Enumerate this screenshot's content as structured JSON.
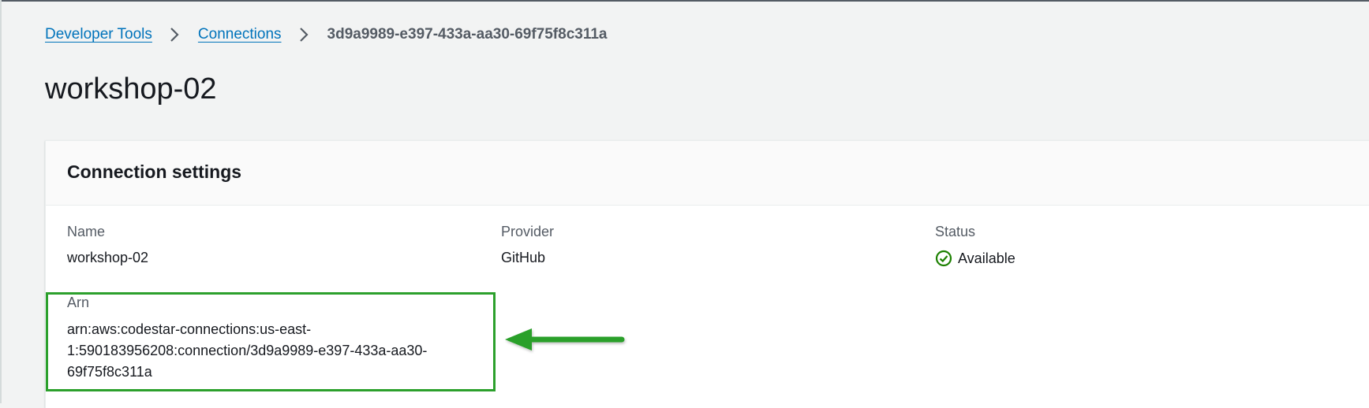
{
  "breadcrumb": {
    "items": [
      {
        "label": "Developer Tools"
      },
      {
        "label": "Connections"
      }
    ],
    "current": "3d9a9989-e397-433a-aa30-69f75f8c311a"
  },
  "page": {
    "title": "workshop-02"
  },
  "connection_settings": {
    "heading": "Connection settings",
    "name_label": "Name",
    "name_value": "workshop-02",
    "provider_label": "Provider",
    "provider_value": "GitHub",
    "status_label": "Status",
    "status_value": "Available",
    "arn_label": "Arn",
    "arn_line1": "arn:aws:codestar-connections:us-east-",
    "arn_line2": "1:590183956208:connection/3d9a9989-e397-433a-aa30-",
    "arn_line3": "69f75f8c311a"
  },
  "colors": {
    "link": "#0073bb",
    "status_available": "#1d8102",
    "annotation_green": "#2ca02c"
  },
  "icons": {
    "breadcrumb_separator": "chevron-right-icon",
    "status": "check-circle-icon",
    "annotation": "arrow-left-icon"
  }
}
